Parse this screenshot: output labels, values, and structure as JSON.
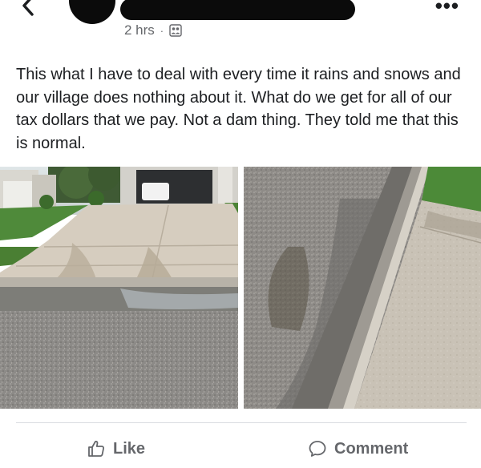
{
  "post": {
    "timestamp": "2 hrs",
    "separator": "·",
    "audience_icon": "friends-icon",
    "text": "This what I have to deal with every time it rains and snows and our village does nothing about it. What do we get for all of our tax dollars that we pay. Not a dam thing. They told me that this is normal."
  },
  "actions": {
    "like_label": "Like",
    "like_icon": "thumbs-up-icon",
    "comment_label": "Comment",
    "comment_icon": "comment-bubble-icon"
  },
  "colors": {
    "secondary_text": "#65676b",
    "primary_text": "#1c1e21",
    "divider": "#dadde1"
  }
}
